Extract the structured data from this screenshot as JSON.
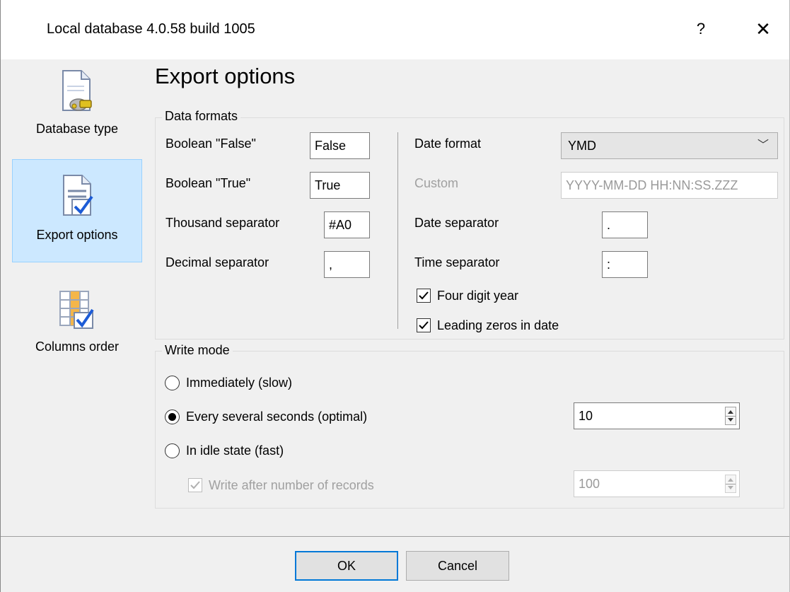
{
  "window": {
    "title": "Local database 4.0.58 build 1005",
    "help_glyph": "?",
    "close_glyph": "✕"
  },
  "sidebar": {
    "items": [
      {
        "label": "Database type",
        "icon": "database-plug-icon",
        "active": false
      },
      {
        "label": "Export options",
        "icon": "document-checkmark-icon",
        "active": true
      },
      {
        "label": "Columns order",
        "icon": "grid-checkmark-icon",
        "active": false
      }
    ]
  },
  "page_title": "Export options",
  "data_formats": {
    "group_label": "Data formats",
    "boolean_false": {
      "label": "Boolean \"False\"",
      "value": "False"
    },
    "boolean_true": {
      "label": "Boolean \"True\"",
      "value": "True"
    },
    "thousand_separator": {
      "label": "Thousand separator",
      "value": "#A0"
    },
    "decimal_separator": {
      "label": "Decimal separator",
      "value": ","
    },
    "date_format": {
      "label": "Date format",
      "value": "YMD"
    },
    "custom": {
      "label": "Custom",
      "value": "YYYY-MM-DD HH:NN:SS.ZZZ"
    },
    "date_separator": {
      "label": "Date separator",
      "value": "."
    },
    "time_separator": {
      "label": "Time separator",
      "value": ":"
    },
    "four_digit_year": {
      "label": "Four digit year",
      "checked": true
    },
    "leading_zeros": {
      "label": "Leading zeros in date",
      "checked": true
    }
  },
  "write_mode": {
    "group_label": "Write mode",
    "immediately": {
      "label": "Immediately (slow)",
      "selected": false
    },
    "every_several": {
      "label": "Every several seconds (optimal)",
      "selected": true,
      "value": "10"
    },
    "idle_state": {
      "label": "In idle state (fast)",
      "selected": false
    },
    "write_after": {
      "label": "Write after number of records",
      "checked": true,
      "disabled": true,
      "value": "100"
    }
  },
  "footer": {
    "ok_label": "OK",
    "cancel_label": "Cancel"
  },
  "colors": {
    "accent": "#0078d7",
    "selected_bg": "#cce8ff",
    "checkmark_blue": "#1c5bd6"
  }
}
